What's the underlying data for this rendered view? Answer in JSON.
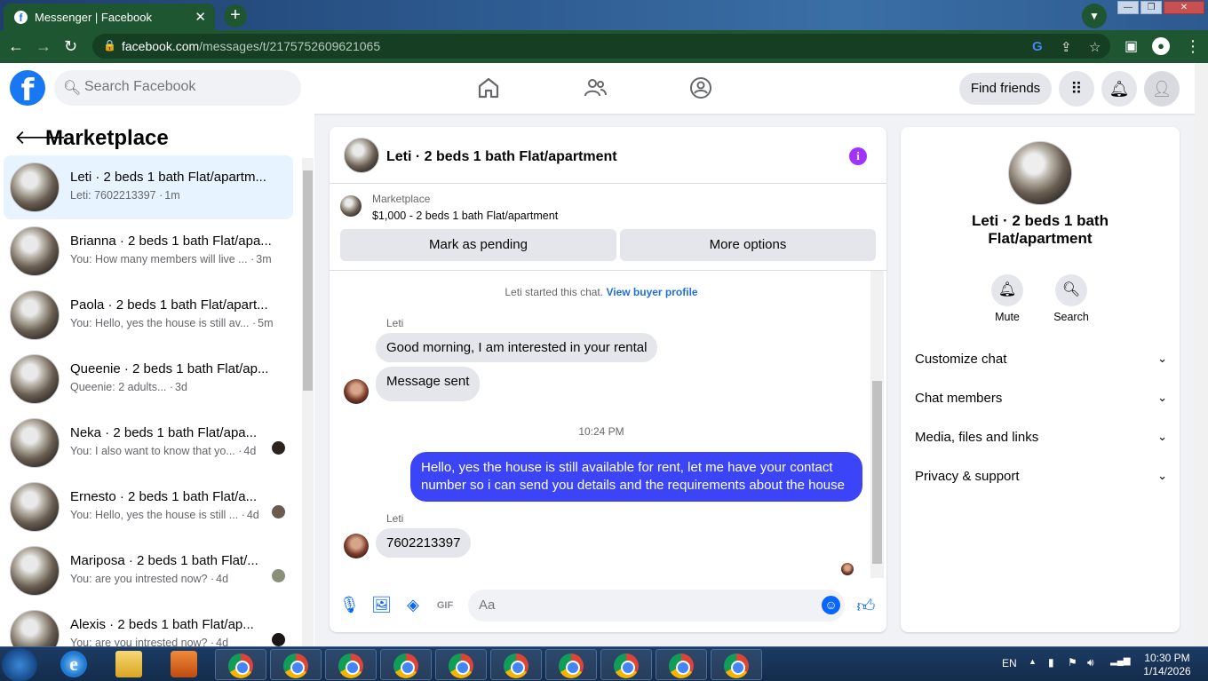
{
  "browser": {
    "tab_title": "Messenger | Facebook",
    "tab_close": "✕",
    "new_tab": "+",
    "url_host": "facebook.com",
    "url_path": "/messages/t/2175752609621065",
    "win_min": "—",
    "win_restore": "❐",
    "win_close": "✕"
  },
  "fb": {
    "logo": "f",
    "search_placeholder": "Search Facebook",
    "find_friends": "Find friends"
  },
  "sidebar": {
    "title": "Marketplace",
    "items": [
      {
        "name": "Leti · 2 beds 1 bath Flat/apartm...",
        "sub": "Leti: 7602213397 ·",
        "time": "1m"
      },
      {
        "name": "Brianna · 2 beds 1 bath Flat/apa...",
        "sub": "You: How many members will live ... ·",
        "time": "3m"
      },
      {
        "name": "Paola · 2 beds 1 bath Flat/apart...",
        "sub": "You: Hello, yes the house is still av... ·",
        "time": "5m"
      },
      {
        "name": "Queenie · 2 beds 1 bath Flat/ap...",
        "sub": "Queenie: 2 adults... ·",
        "time": "3d"
      },
      {
        "name": "Neka · 2 beds 1 bath Flat/apa...",
        "sub": "You: I also want to know that yo... ·",
        "time": "4d"
      },
      {
        "name": "Ernesto · 2 beds 1 bath Flat/a...",
        "sub": "You: Hello, yes the house is still ... ·",
        "time": "4d"
      },
      {
        "name": "Mariposa · 2 beds 1 bath Flat/...",
        "sub": "You: are you intrested now? ·",
        "time": "4d"
      },
      {
        "name": "Alexis · 2 beds 1 bath Flat/ap...",
        "sub": "You: are you intrested now? ·",
        "time": "4d"
      }
    ]
  },
  "chat": {
    "title": "Leti · 2 beds 1 bath Flat/apartment",
    "info": "i",
    "marketplace_label": "Marketplace",
    "listing": "$1,000 - 2 beds 1 bath Flat/apartment",
    "mark_pending": "Mark as pending",
    "more_options": "More options",
    "started_text": "Leti started this chat.",
    "buyer_profile": "View buyer profile",
    "sender1": "Leti",
    "msg1": "Good morning, I am interested in your rental",
    "msg2": "Message sent",
    "time": "10:24 PM",
    "msg3": "Hello, yes the house is still available for rent, let me have your contact number so i can send you details and the requirements about the house",
    "sender2": "Leti",
    "msg4": "7602213397",
    "input_placeholder": "Aa",
    "gif": "GIF"
  },
  "rpanel": {
    "name": "Leti · 2 beds 1 bath Flat/apartment",
    "mute": "Mute",
    "search": "Search",
    "rows": [
      "Customize chat",
      "Chat members",
      "Media, files and links",
      "Privacy & support"
    ]
  },
  "taskbar": {
    "lang": "EN",
    "time": "10:30 PM",
    "date": "1/14/2026"
  },
  "colors": {
    "fb_blue": "#1877f2",
    "outgoing_bubble": "#3b44f6",
    "browser_green": "#1e5631",
    "info_purple": "#a033ff"
  }
}
